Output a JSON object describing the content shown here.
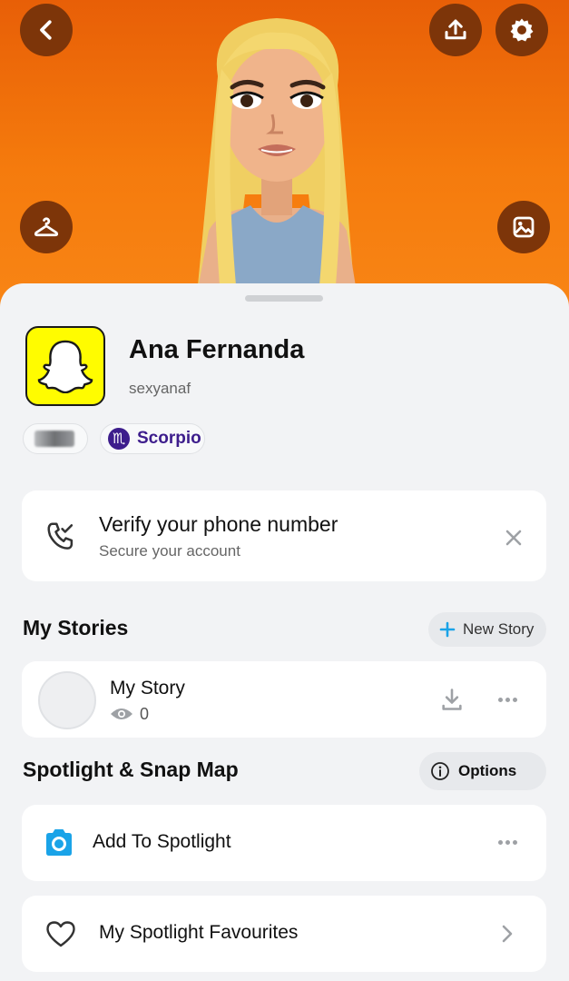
{
  "profile": {
    "display_name": "Ana Fernanda",
    "username": "sexyanaf",
    "zodiac": "Scorpio"
  },
  "verify_card": {
    "title": "Verify your phone number",
    "subtitle": "Secure your account"
  },
  "my_stories": {
    "section_title": "My Stories",
    "new_story_label": "New Story",
    "story_title": "My Story",
    "view_count": "0"
  },
  "spotlight": {
    "section_title": "Spotlight & Snap Map",
    "options_label": "Options",
    "add_label": "Add To Spotlight",
    "favourites_label": "My Spotlight Favourites"
  },
  "colors": {
    "hero": "#f57b0d",
    "snap_yellow": "#fffc00",
    "zodiac_purple": "#3d1d8c",
    "accent_blue": "#1aa3e8"
  },
  "icons": {
    "back": "chevron-left-icon",
    "share": "upload-icon",
    "settings": "gear-icon",
    "wardrobe": "hanger-icon",
    "background": "image-icon",
    "verify": "phone-check-icon",
    "close": "close-icon",
    "download": "download-icon",
    "view": "eye-icon",
    "camera": "camera-icon",
    "heart": "heart-icon",
    "chevron": "chevron-right-icon"
  }
}
